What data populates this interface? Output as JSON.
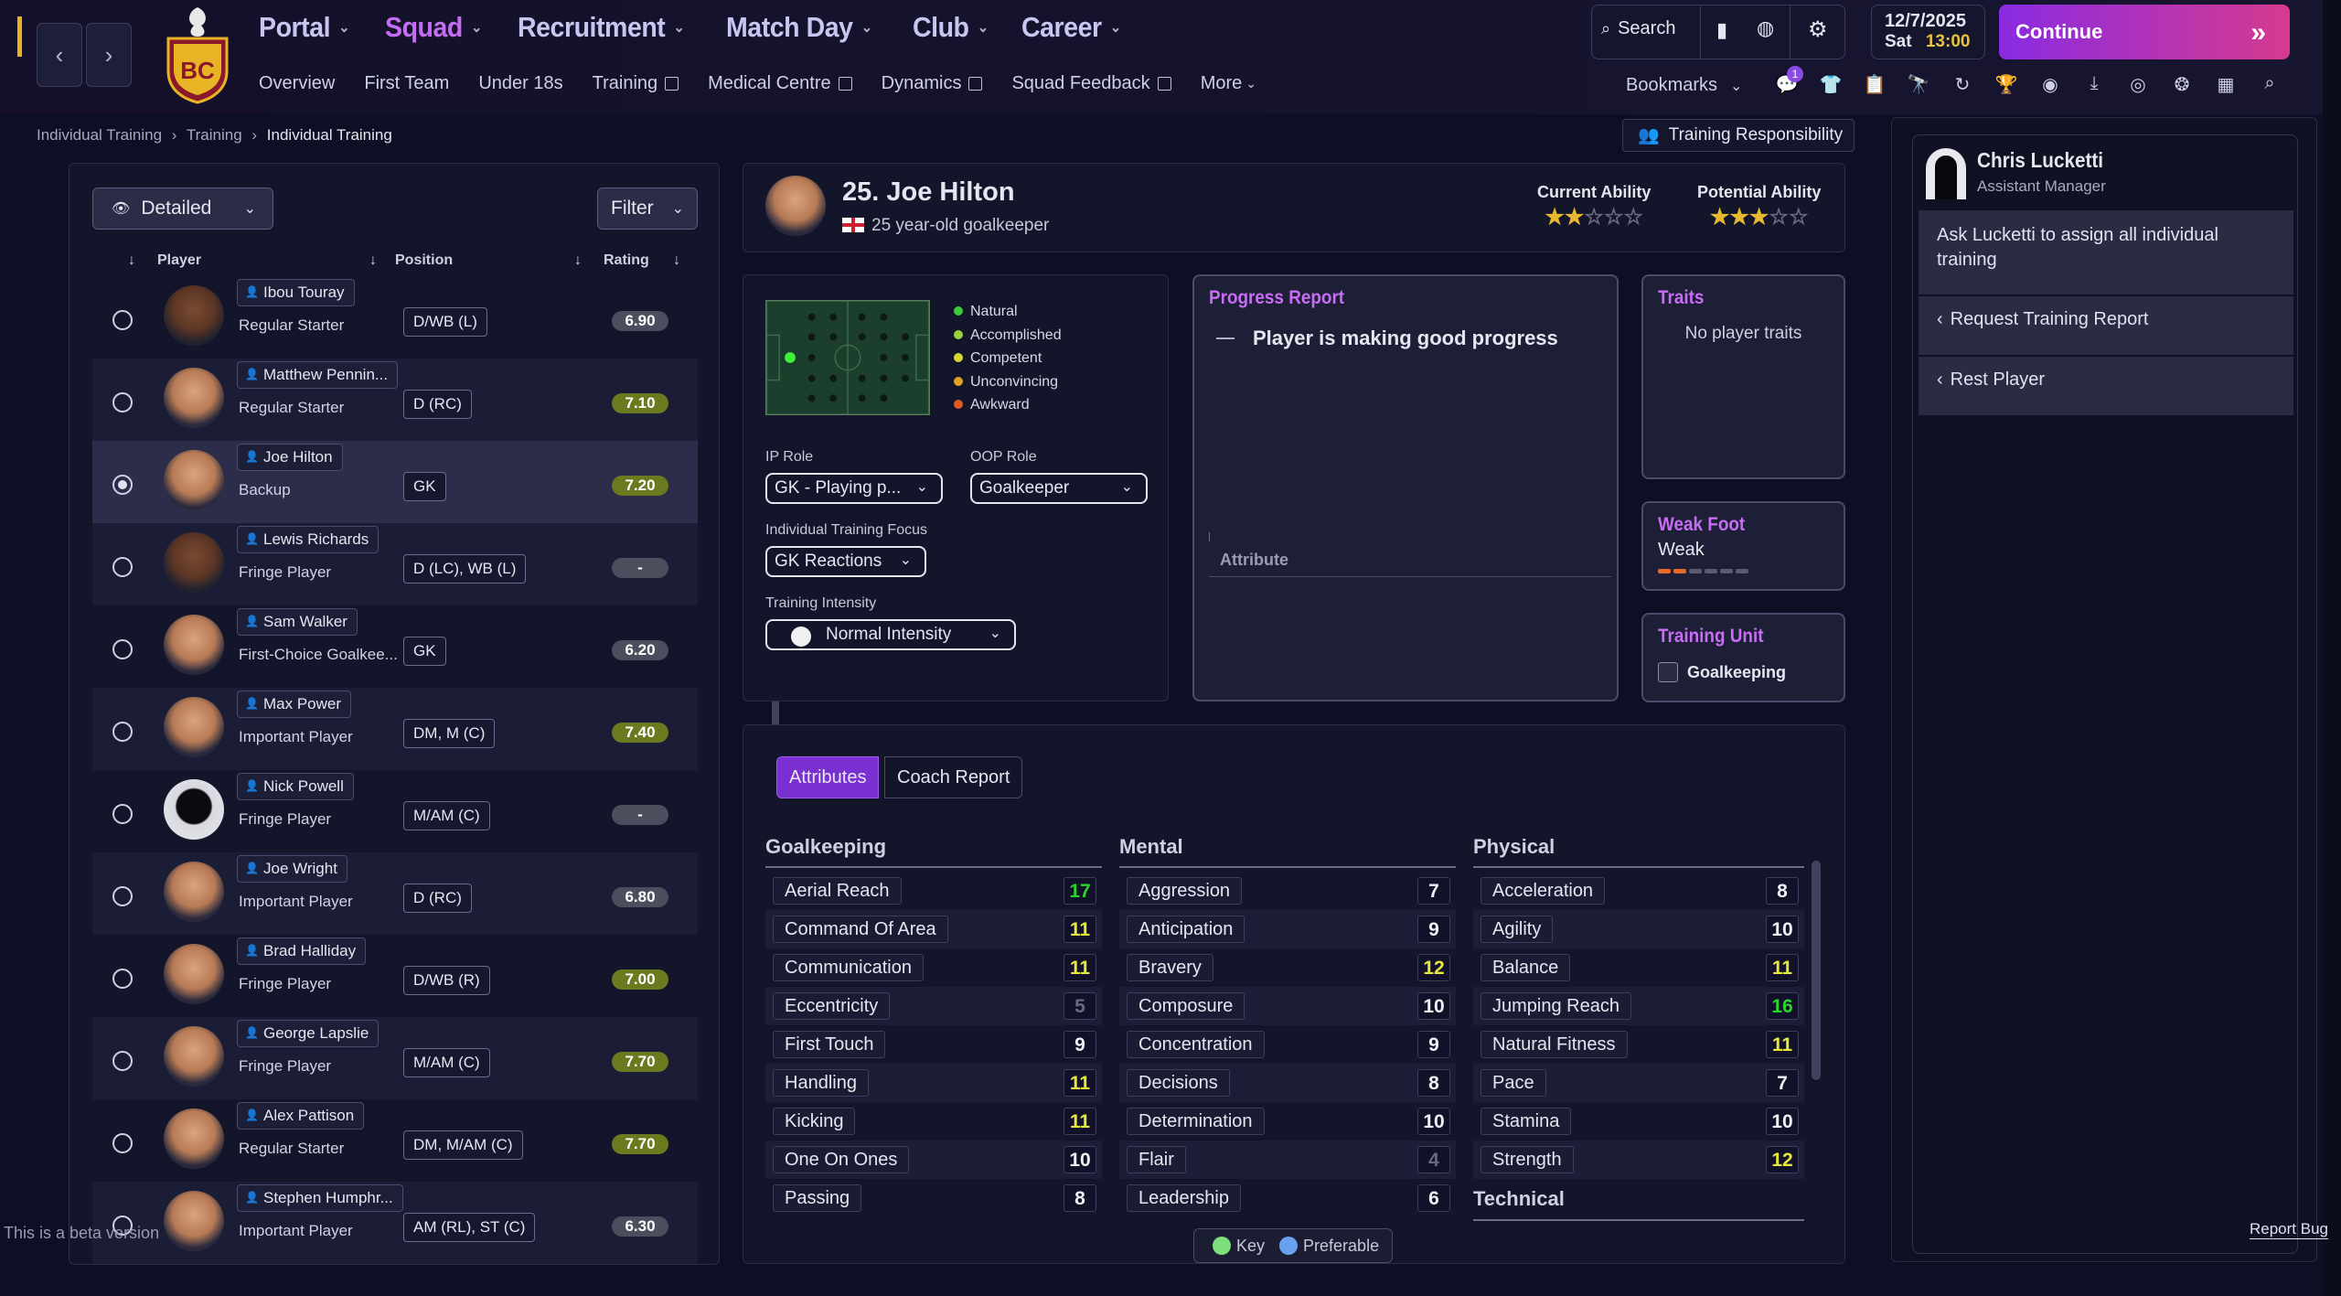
{
  "topbar": {
    "main_menu": [
      {
        "label": "Portal",
        "active": false
      },
      {
        "label": "Squad",
        "active": true
      },
      {
        "label": "Recruitment",
        "active": false
      },
      {
        "label": "Match Day",
        "active": false
      },
      {
        "label": "Club",
        "active": false
      },
      {
        "label": "Career",
        "active": false
      }
    ],
    "sub_menu": [
      "Overview",
      "First Team",
      "Under 18s",
      "Training",
      "Medical Centre",
      "Dynamics",
      "Squad Feedback",
      "More"
    ],
    "search_label": "Search",
    "date": "12/7/2025",
    "day": "Sat",
    "time": "13:00",
    "continue_label": "Continue",
    "bookmarks_label": "Bookmarks",
    "notification_count": "1"
  },
  "breadcrumb": [
    "Individual Training",
    "Training",
    "Individual Training"
  ],
  "training_responsibility_label": "Training Responsibility",
  "list": {
    "view_label": "Detailed",
    "filter_label": "Filter",
    "columns": [
      "Player",
      "Position",
      "Rating"
    ],
    "players": [
      {
        "name": "Ibou Touray",
        "role": "Regular Starter",
        "pos": "D/WB (L)",
        "rating": "6.90",
        "green": false,
        "face": "dark"
      },
      {
        "name": "Matthew Pennin...",
        "role": "Regular Starter",
        "pos": "D (RC)",
        "rating": "7.10",
        "green": true,
        "face": "light"
      },
      {
        "name": "Joe Hilton",
        "role": "Backup",
        "pos": "GK",
        "rating": "7.20",
        "green": true,
        "face": "light",
        "selected": true
      },
      {
        "name": "Lewis Richards",
        "role": "Fringe Player",
        "pos": "D (LC), WB (L)",
        "rating": "-",
        "green": false,
        "face": "dark"
      },
      {
        "name": "Sam Walker",
        "role": "First-Choice Goalkee...",
        "pos": "GK",
        "rating": "6.20",
        "green": false,
        "face": "light"
      },
      {
        "name": "Max Power",
        "role": "Important Player",
        "pos": "DM, M (C)",
        "rating": "7.40",
        "green": true,
        "face": "light"
      },
      {
        "name": "Nick Powell",
        "role": "Fringe Player",
        "pos": "M/AM (C)",
        "rating": "-",
        "green": false,
        "face": "sil"
      },
      {
        "name": "Joe Wright",
        "role": "Important Player",
        "pos": "D (RC)",
        "rating": "6.80",
        "green": false,
        "face": "light"
      },
      {
        "name": "Brad Halliday",
        "role": "Fringe Player",
        "pos": "D/WB (R)",
        "rating": "7.00",
        "green": true,
        "face": "light"
      },
      {
        "name": "George Lapslie",
        "role": "Fringe Player",
        "pos": "M/AM (C)",
        "rating": "7.70",
        "green": true,
        "face": "light"
      },
      {
        "name": "Alex Pattison",
        "role": "Regular Starter",
        "pos": "DM, M/AM (C)",
        "rating": "7.70",
        "green": true,
        "face": "light"
      },
      {
        "name": "Stephen Humphr...",
        "role": "Important Player",
        "pos": "AM (RL), ST (C)",
        "rating": "6.30",
        "green": false,
        "face": "light"
      }
    ]
  },
  "player": {
    "name": "25. Joe Hilton",
    "description": "25 year-old goalkeeper",
    "current_ability_label": "Current Ability",
    "potential_ability_label": "Potential Ability",
    "current_ability_stars": 2,
    "potential_ability_stars": 3,
    "stars_total": 5
  },
  "roles": {
    "legend": [
      {
        "label": "Natural",
        "color": "#3ccc3c"
      },
      {
        "label": "Accomplished",
        "color": "#9ad03a"
      },
      {
        "label": "Competent",
        "color": "#d8d830"
      },
      {
        "label": "Unconvincing",
        "color": "#e0a020"
      },
      {
        "label": "Awkward",
        "color": "#e05a20"
      }
    ],
    "ip_role_label": "IP Role",
    "ip_role_value": "GK - Playing p...",
    "oop_role_label": "OOP Role",
    "oop_role_value": "Goalkeeper",
    "focus_label": "Individual Training Focus",
    "focus_value": "GK Reactions",
    "intensity_label": "Training Intensity",
    "intensity_value": "Normal Intensity"
  },
  "progress": {
    "title": "Progress Report",
    "message": "Player is making good progress",
    "attribute_label": "Attribute"
  },
  "traits": {
    "title": "Traits",
    "text": "No player traits"
  },
  "weak_foot": {
    "title": "Weak Foot",
    "value": "Weak",
    "level": 2,
    "max": 6
  },
  "training_unit": {
    "title": "Training Unit",
    "value": "Goalkeeping"
  },
  "attributes": {
    "tabs": [
      "Attributes",
      "Coach Report"
    ],
    "goalkeeping": {
      "title": "Goalkeeping",
      "items": [
        {
          "name": "Aerial Reach",
          "value": "17"
        },
        {
          "name": "Command Of Area",
          "value": "11"
        },
        {
          "name": "Communication",
          "value": "11"
        },
        {
          "name": "Eccentricity",
          "value": "5"
        },
        {
          "name": "First Touch",
          "value": "9"
        },
        {
          "name": "Handling",
          "value": "11"
        },
        {
          "name": "Kicking",
          "value": "11"
        },
        {
          "name": "One On Ones",
          "value": "10"
        },
        {
          "name": "Passing",
          "value": "8"
        }
      ]
    },
    "mental": {
      "title": "Mental",
      "items": [
        {
          "name": "Aggression",
          "value": "7"
        },
        {
          "name": "Anticipation",
          "value": "9"
        },
        {
          "name": "Bravery",
          "value": "12"
        },
        {
          "name": "Composure",
          "value": "10"
        },
        {
          "name": "Concentration",
          "value": "9"
        },
        {
          "name": "Decisions",
          "value": "8"
        },
        {
          "name": "Determination",
          "value": "10"
        },
        {
          "name": "Flair",
          "value": "4"
        },
        {
          "name": "Leadership",
          "value": "6"
        }
      ]
    },
    "physical": {
      "title": "Physical",
      "items": [
        {
          "name": "Acceleration",
          "value": "8"
        },
        {
          "name": "Agility",
          "value": "10"
        },
        {
          "name": "Balance",
          "value": "11"
        },
        {
          "name": "Jumping Reach",
          "value": "16"
        },
        {
          "name": "Natural Fitness",
          "value": "11"
        },
        {
          "name": "Pace",
          "value": "7"
        },
        {
          "name": "Stamina",
          "value": "10"
        },
        {
          "name": "Strength",
          "value": "12"
        }
      ]
    },
    "technical_title": "Technical",
    "key_label": "Key",
    "preferable_label": "Preferable"
  },
  "staff": {
    "name": "Chris Lucketti",
    "role": "Assistant Manager",
    "actions": [
      "Ask Lucketti to assign all individual training",
      "Request Training Report",
      "Rest Player"
    ]
  },
  "footer": {
    "beta_text": "This is a beta version",
    "report_bug": "Report Bug"
  }
}
